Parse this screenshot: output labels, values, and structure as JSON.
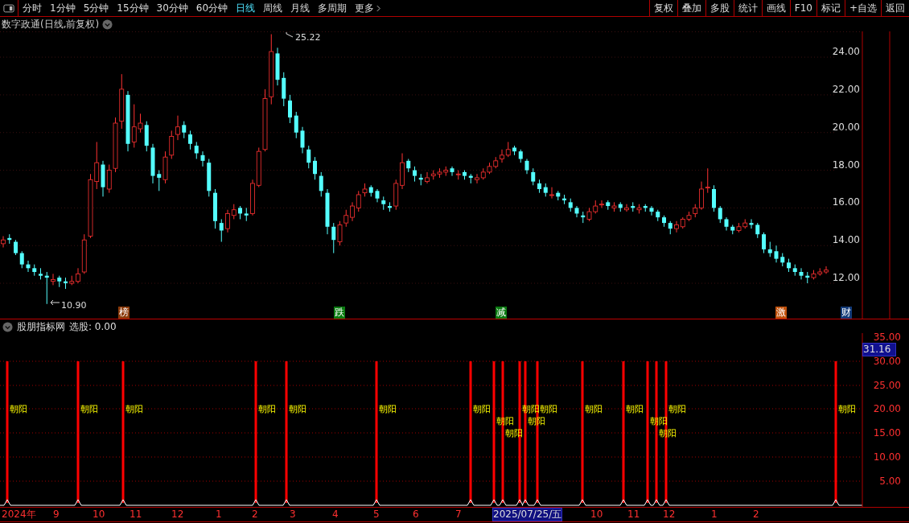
{
  "toolbar": {
    "periods": [
      {
        "label": "分时",
        "selected": false
      },
      {
        "label": "1分钟",
        "selected": false
      },
      {
        "label": "5分钟",
        "selected": false
      },
      {
        "label": "15分钟",
        "selected": false
      },
      {
        "label": "30分钟",
        "selected": false
      },
      {
        "label": "60分钟",
        "selected": false
      },
      {
        "label": "日线",
        "selected": true
      },
      {
        "label": "周线",
        "selected": false
      },
      {
        "label": "月线",
        "selected": false
      },
      {
        "label": "多周期",
        "selected": false
      }
    ],
    "more": "更多",
    "actions": [
      "复权",
      "叠加",
      "多股",
      "统计",
      "画线",
      "F10",
      "标记",
      "+自选",
      "返回"
    ]
  },
  "main_chart": {
    "title": "数字政通(日线,前复权)",
    "high_label": "25.22",
    "low_label": "10.90",
    "chart_data": {
      "type": "candlestick",
      "grid": true,
      "ylim": [
        10.08,
        25.37
      ],
      "yticks": [
        {
          "value": 24,
          "label": "24.00"
        },
        {
          "value": 22,
          "label": "22.00"
        },
        {
          "value": 20,
          "label": "20.00"
        },
        {
          "value": 18,
          "label": "18.00"
        },
        {
          "value": 16,
          "label": "16.00"
        },
        {
          "value": 14,
          "label": "14.00"
        },
        {
          "value": 12,
          "label": "12.00"
        }
      ],
      "ohlc": [
        [
          14.1,
          14.5,
          13.9,
          14.3
        ],
        [
          14.4,
          14.6,
          14.1,
          14.3
        ],
        [
          14.2,
          14.3,
          13.5,
          13.6
        ],
        [
          13.6,
          13.7,
          12.8,
          13.0
        ],
        [
          13.0,
          13.2,
          12.6,
          12.8
        ],
        [
          12.8,
          13.0,
          12.4,
          12.6
        ],
        [
          12.5,
          12.8,
          12.2,
          12.4
        ],
        [
          12.4,
          12.6,
          10.9,
          12.3
        ],
        [
          12.1,
          12.5,
          11.9,
          12.2
        ],
        [
          12.3,
          12.4,
          11.8,
          12.1
        ],
        [
          12.1,
          12.3,
          11.7,
          12.0
        ],
        [
          12.0,
          12.4,
          11.9,
          12.1
        ],
        [
          12.1,
          12.8,
          12.0,
          12.5
        ],
        [
          12.6,
          14.6,
          12.5,
          14.3
        ],
        [
          14.5,
          17.8,
          14.4,
          17.5
        ],
        [
          17.4,
          19.5,
          17.0,
          18.4
        ],
        [
          18.3,
          18.5,
          16.6,
          17.1
        ],
        [
          17.0,
          18.3,
          16.8,
          18.0
        ],
        [
          18.1,
          20.8,
          17.9,
          20.5
        ],
        [
          20.6,
          23.1,
          20.2,
          22.3
        ],
        [
          22.0,
          22.2,
          19.0,
          19.4
        ],
        [
          19.5,
          21.5,
          19.2,
          20.3
        ],
        [
          20.2,
          21.0,
          20.0,
          20.5
        ],
        [
          20.4,
          20.6,
          19.0,
          19.3
        ],
        [
          19.2,
          19.4,
          17.3,
          17.7
        ],
        [
          17.8,
          18.0,
          16.9,
          17.6
        ],
        [
          17.5,
          19.0,
          17.3,
          18.7
        ],
        [
          18.8,
          20.1,
          18.6,
          19.8
        ],
        [
          19.9,
          20.9,
          19.6,
          20.3
        ],
        [
          20.4,
          20.6,
          19.7,
          20.0
        ],
        [
          19.9,
          20.1,
          19.1,
          19.4
        ],
        [
          19.3,
          19.5,
          18.6,
          18.9
        ],
        [
          18.8,
          19.0,
          18.2,
          18.5
        ],
        [
          18.4,
          18.6,
          16.6,
          16.9
        ],
        [
          16.8,
          17.0,
          14.9,
          15.3
        ],
        [
          15.2,
          15.4,
          14.2,
          14.8
        ],
        [
          14.9,
          15.9,
          14.7,
          15.7
        ],
        [
          15.6,
          16.2,
          15.4,
          15.9
        ],
        [
          16.0,
          16.1,
          15.4,
          15.7
        ],
        [
          15.7,
          16.0,
          15.3,
          15.6
        ],
        [
          15.7,
          17.5,
          15.6,
          17.3
        ],
        [
          17.2,
          19.2,
          17.1,
          19.0
        ],
        [
          19.1,
          22.3,
          19.0,
          21.8
        ],
        [
          21.9,
          25.22,
          21.5,
          24.3
        ],
        [
          24.2,
          24.5,
          22.5,
          22.8
        ],
        [
          22.9,
          23.2,
          21.4,
          21.8
        ],
        [
          21.7,
          22.0,
          20.5,
          20.8
        ],
        [
          20.9,
          21.1,
          19.7,
          20.0
        ],
        [
          20.1,
          20.3,
          18.9,
          19.2
        ],
        [
          19.1,
          19.3,
          18.1,
          18.4
        ],
        [
          18.5,
          18.7,
          17.5,
          17.8
        ],
        [
          17.7,
          17.9,
          16.6,
          16.9
        ],
        [
          16.8,
          17.0,
          14.6,
          15.0
        ],
        [
          15.0,
          15.2,
          13.6,
          14.3
        ],
        [
          14.2,
          15.3,
          14.0,
          15.1
        ],
        [
          15.2,
          15.9,
          15.0,
          15.6
        ],
        [
          15.5,
          16.3,
          15.3,
          16.1
        ],
        [
          16.0,
          16.9,
          15.8,
          16.7
        ],
        [
          16.8,
          17.3,
          16.6,
          17.0
        ],
        [
          17.1,
          17.2,
          16.6,
          16.8
        ],
        [
          16.9,
          17.0,
          16.3,
          16.5
        ],
        [
          16.4,
          16.6,
          15.9,
          16.2
        ],
        [
          16.1,
          16.3,
          15.8,
          16.0
        ],
        [
          16.1,
          17.5,
          15.9,
          17.3
        ],
        [
          17.2,
          18.9,
          17.0,
          18.4
        ],
        [
          18.5,
          18.6,
          17.9,
          18.1
        ],
        [
          18.0,
          18.2,
          17.4,
          17.7
        ],
        [
          17.6,
          17.8,
          17.2,
          17.5
        ],
        [
          17.4,
          17.9,
          17.3,
          17.6
        ],
        [
          17.7,
          18.0,
          17.5,
          17.8
        ],
        [
          17.8,
          18.1,
          17.6,
          17.9
        ],
        [
          17.9,
          18.2,
          17.7,
          18.0
        ],
        [
          18.1,
          18.2,
          17.7,
          17.9
        ],
        [
          17.8,
          18.0,
          17.5,
          17.8
        ],
        [
          17.9,
          18.0,
          17.5,
          17.7
        ],
        [
          17.7,
          17.8,
          17.3,
          17.6
        ],
        [
          17.5,
          17.8,
          17.3,
          17.6
        ],
        [
          17.6,
          18.1,
          17.5,
          17.9
        ],
        [
          17.9,
          18.4,
          17.8,
          18.2
        ],
        [
          18.2,
          18.7,
          18.1,
          18.5
        ],
        [
          18.6,
          19.1,
          18.4,
          18.8
        ],
        [
          18.8,
          19.5,
          18.7,
          19.1
        ],
        [
          19.2,
          19.3,
          18.8,
          19.0
        ],
        [
          19.0,
          19.1,
          18.4,
          18.6
        ],
        [
          18.5,
          18.6,
          17.8,
          18.0
        ],
        [
          17.9,
          18.1,
          17.2,
          17.4
        ],
        [
          17.3,
          17.5,
          16.8,
          17.0
        ],
        [
          17.1,
          17.3,
          16.6,
          16.8
        ],
        [
          16.7,
          17.1,
          16.5,
          16.7
        ],
        [
          16.8,
          16.9,
          16.4,
          16.6
        ],
        [
          16.5,
          16.7,
          16.2,
          16.4
        ],
        [
          16.3,
          16.5,
          15.8,
          16.0
        ],
        [
          16.0,
          16.1,
          15.5,
          15.7
        ],
        [
          15.6,
          15.8,
          15.2,
          15.5
        ],
        [
          15.4,
          16.0,
          15.3,
          15.8
        ],
        [
          15.8,
          16.4,
          15.7,
          16.1
        ],
        [
          16.2,
          16.4,
          16.0,
          16.2
        ],
        [
          16.3,
          16.4,
          15.9,
          16.1
        ],
        [
          16.0,
          16.3,
          15.8,
          16.1
        ],
        [
          16.2,
          16.3,
          15.8,
          16.0
        ],
        [
          15.9,
          16.2,
          15.8,
          16.0
        ],
        [
          16.1,
          16.3,
          15.8,
          16.0
        ],
        [
          15.9,
          16.2,
          15.7,
          16.0
        ],
        [
          16.1,
          16.2,
          15.8,
          16.0
        ],
        [
          16.0,
          16.1,
          15.6,
          15.8
        ],
        [
          15.8,
          15.9,
          15.3,
          15.5
        ],
        [
          15.5,
          15.6,
          15.0,
          15.2
        ],
        [
          15.2,
          15.3,
          14.6,
          14.9
        ],
        [
          14.9,
          15.3,
          14.7,
          15.1
        ],
        [
          15.0,
          15.5,
          14.9,
          15.4
        ],
        [
          15.4,
          15.8,
          15.3,
          15.6
        ],
        [
          15.7,
          16.2,
          15.5,
          16.0
        ],
        [
          16.0,
          17.4,
          15.9,
          17.0
        ],
        [
          17.1,
          18.1,
          16.8,
          17.1
        ],
        [
          17.0,
          17.2,
          15.8,
          16.0
        ],
        [
          16.0,
          16.1,
          15.2,
          15.4
        ],
        [
          15.4,
          15.5,
          14.8,
          15.0
        ],
        [
          15.0,
          15.1,
          14.6,
          14.8
        ],
        [
          14.8,
          15.2,
          14.7,
          15.0
        ],
        [
          15.0,
          15.4,
          14.9,
          15.2
        ],
        [
          15.2,
          15.4,
          14.9,
          15.1
        ],
        [
          15.1,
          15.2,
          14.4,
          14.6
        ],
        [
          14.6,
          14.7,
          13.6,
          13.8
        ],
        [
          13.8,
          14.2,
          13.4,
          13.6
        ],
        [
          13.7,
          14.0,
          13.1,
          13.3
        ],
        [
          13.4,
          13.6,
          12.9,
          13.1
        ],
        [
          13.1,
          13.3,
          12.6,
          12.8
        ],
        [
          12.8,
          13.0,
          12.4,
          12.6
        ],
        [
          12.6,
          12.8,
          12.2,
          12.4
        ],
        [
          12.4,
          12.6,
          12.0,
          12.3
        ],
        [
          12.3,
          12.7,
          12.2,
          12.5
        ],
        [
          12.5,
          12.8,
          12.4,
          12.6
        ],
        [
          12.6,
          12.9,
          12.5,
          12.7
        ]
      ]
    },
    "events": [
      {
        "label": "榜",
        "color": "#8b3a0a"
      },
      {
        "label": "跌",
        "color": "#0a7a10"
      },
      {
        "label": "减",
        "color": "#0a7a10"
      },
      {
        "label": "激",
        "color": "#c0500a"
      },
      {
        "label": "财",
        "color": "#123a78"
      }
    ]
  },
  "indicator": {
    "name": "股朋指标网",
    "reading": "选股: 0.00",
    "current_value": "31.16",
    "y_labels": [
      "35.00",
      "30.00",
      "25.00",
      "20.00",
      "15.00",
      "10.00",
      "5.00"
    ],
    "signals": [
      {
        "label": "朝阳"
      },
      {
        "label": "朝阳"
      },
      {
        "label": "朝阳"
      },
      {
        "label": "朝阳"
      },
      {
        "label": "朝阳"
      },
      {
        "label": "朝阳"
      },
      {
        "label": "朝阳"
      },
      {
        "label": "朝阳"
      },
      {
        "label": "朝阳"
      },
      {
        "label": "朝阳"
      },
      {
        "label": "朝阳"
      },
      {
        "label": "朝阳"
      },
      {
        "label": "朝阳"
      },
      {
        "label": "朝阳"
      },
      {
        "label": "朝阳"
      },
      {
        "label": "朝阳"
      },
      {
        "label": "朝阳"
      },
      {
        "label": "朝阳"
      }
    ]
  },
  "date_axis": [
    {
      "text": "2024年",
      "selected": false
    },
    {
      "text": "9",
      "selected": false
    },
    {
      "text": "10",
      "selected": false
    },
    {
      "text": "11",
      "selected": false
    },
    {
      "text": "12",
      "selected": false
    },
    {
      "text": "1",
      "selected": false
    },
    {
      "text": "2",
      "selected": false
    },
    {
      "text": "3",
      "selected": false
    },
    {
      "text": "4",
      "selected": false
    },
    {
      "text": "5",
      "selected": false
    },
    {
      "text": "6",
      "selected": false
    },
    {
      "text": "7",
      "selected": false
    },
    {
      "text": "2025/07/25/五",
      "selected": true
    },
    {
      "text": "10",
      "selected": false
    },
    {
      "text": "11",
      "selected": false
    },
    {
      "text": "12",
      "selected": false
    },
    {
      "text": "1",
      "selected": false
    },
    {
      "text": "2",
      "selected": false
    }
  ]
}
